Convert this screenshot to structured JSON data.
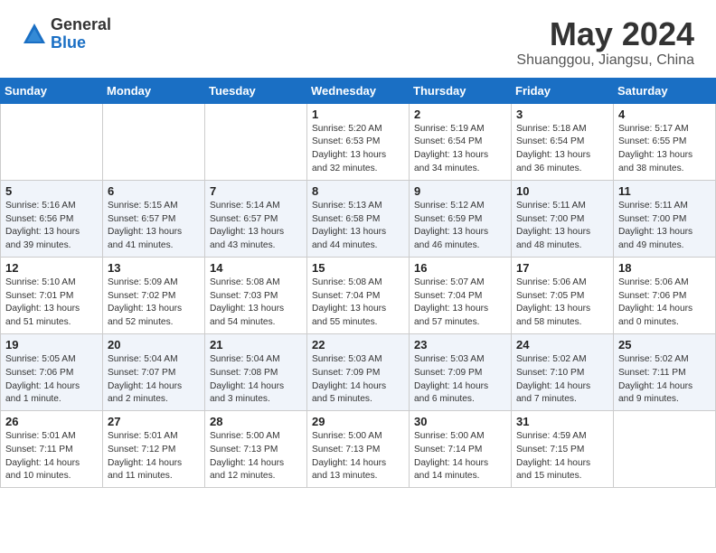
{
  "logo": {
    "general": "General",
    "blue": "Blue"
  },
  "title": {
    "month_year": "May 2024",
    "location": "Shuanggou, Jiangsu, China"
  },
  "days_of_week": [
    "Sunday",
    "Monday",
    "Tuesday",
    "Wednesday",
    "Thursday",
    "Friday",
    "Saturday"
  ],
  "weeks": [
    [
      {
        "day": "",
        "info": ""
      },
      {
        "day": "",
        "info": ""
      },
      {
        "day": "",
        "info": ""
      },
      {
        "day": "1",
        "info": "Sunrise: 5:20 AM\nSunset: 6:53 PM\nDaylight: 13 hours\nand 32 minutes."
      },
      {
        "day": "2",
        "info": "Sunrise: 5:19 AM\nSunset: 6:54 PM\nDaylight: 13 hours\nand 34 minutes."
      },
      {
        "day": "3",
        "info": "Sunrise: 5:18 AM\nSunset: 6:54 PM\nDaylight: 13 hours\nand 36 minutes."
      },
      {
        "day": "4",
        "info": "Sunrise: 5:17 AM\nSunset: 6:55 PM\nDaylight: 13 hours\nand 38 minutes."
      }
    ],
    [
      {
        "day": "5",
        "info": "Sunrise: 5:16 AM\nSunset: 6:56 PM\nDaylight: 13 hours\nand 39 minutes."
      },
      {
        "day": "6",
        "info": "Sunrise: 5:15 AM\nSunset: 6:57 PM\nDaylight: 13 hours\nand 41 minutes."
      },
      {
        "day": "7",
        "info": "Sunrise: 5:14 AM\nSunset: 6:57 PM\nDaylight: 13 hours\nand 43 minutes."
      },
      {
        "day": "8",
        "info": "Sunrise: 5:13 AM\nSunset: 6:58 PM\nDaylight: 13 hours\nand 44 minutes."
      },
      {
        "day": "9",
        "info": "Sunrise: 5:12 AM\nSunset: 6:59 PM\nDaylight: 13 hours\nand 46 minutes."
      },
      {
        "day": "10",
        "info": "Sunrise: 5:11 AM\nSunset: 7:00 PM\nDaylight: 13 hours\nand 48 minutes."
      },
      {
        "day": "11",
        "info": "Sunrise: 5:11 AM\nSunset: 7:00 PM\nDaylight: 13 hours\nand 49 minutes."
      }
    ],
    [
      {
        "day": "12",
        "info": "Sunrise: 5:10 AM\nSunset: 7:01 PM\nDaylight: 13 hours\nand 51 minutes."
      },
      {
        "day": "13",
        "info": "Sunrise: 5:09 AM\nSunset: 7:02 PM\nDaylight: 13 hours\nand 52 minutes."
      },
      {
        "day": "14",
        "info": "Sunrise: 5:08 AM\nSunset: 7:03 PM\nDaylight: 13 hours\nand 54 minutes."
      },
      {
        "day": "15",
        "info": "Sunrise: 5:08 AM\nSunset: 7:04 PM\nDaylight: 13 hours\nand 55 minutes."
      },
      {
        "day": "16",
        "info": "Sunrise: 5:07 AM\nSunset: 7:04 PM\nDaylight: 13 hours\nand 57 minutes."
      },
      {
        "day": "17",
        "info": "Sunrise: 5:06 AM\nSunset: 7:05 PM\nDaylight: 13 hours\nand 58 minutes."
      },
      {
        "day": "18",
        "info": "Sunrise: 5:06 AM\nSunset: 7:06 PM\nDaylight: 14 hours\nand 0 minutes."
      }
    ],
    [
      {
        "day": "19",
        "info": "Sunrise: 5:05 AM\nSunset: 7:06 PM\nDaylight: 14 hours\nand 1 minute."
      },
      {
        "day": "20",
        "info": "Sunrise: 5:04 AM\nSunset: 7:07 PM\nDaylight: 14 hours\nand 2 minutes."
      },
      {
        "day": "21",
        "info": "Sunrise: 5:04 AM\nSunset: 7:08 PM\nDaylight: 14 hours\nand 3 minutes."
      },
      {
        "day": "22",
        "info": "Sunrise: 5:03 AM\nSunset: 7:09 PM\nDaylight: 14 hours\nand 5 minutes."
      },
      {
        "day": "23",
        "info": "Sunrise: 5:03 AM\nSunset: 7:09 PM\nDaylight: 14 hours\nand 6 minutes."
      },
      {
        "day": "24",
        "info": "Sunrise: 5:02 AM\nSunset: 7:10 PM\nDaylight: 14 hours\nand 7 minutes."
      },
      {
        "day": "25",
        "info": "Sunrise: 5:02 AM\nSunset: 7:11 PM\nDaylight: 14 hours\nand 9 minutes."
      }
    ],
    [
      {
        "day": "26",
        "info": "Sunrise: 5:01 AM\nSunset: 7:11 PM\nDaylight: 14 hours\nand 10 minutes."
      },
      {
        "day": "27",
        "info": "Sunrise: 5:01 AM\nSunset: 7:12 PM\nDaylight: 14 hours\nand 11 minutes."
      },
      {
        "day": "28",
        "info": "Sunrise: 5:00 AM\nSunset: 7:13 PM\nDaylight: 14 hours\nand 12 minutes."
      },
      {
        "day": "29",
        "info": "Sunrise: 5:00 AM\nSunset: 7:13 PM\nDaylight: 14 hours\nand 13 minutes."
      },
      {
        "day": "30",
        "info": "Sunrise: 5:00 AM\nSunset: 7:14 PM\nDaylight: 14 hours\nand 14 minutes."
      },
      {
        "day": "31",
        "info": "Sunrise: 4:59 AM\nSunset: 7:15 PM\nDaylight: 14 hours\nand 15 minutes."
      },
      {
        "day": "",
        "info": ""
      }
    ]
  ]
}
